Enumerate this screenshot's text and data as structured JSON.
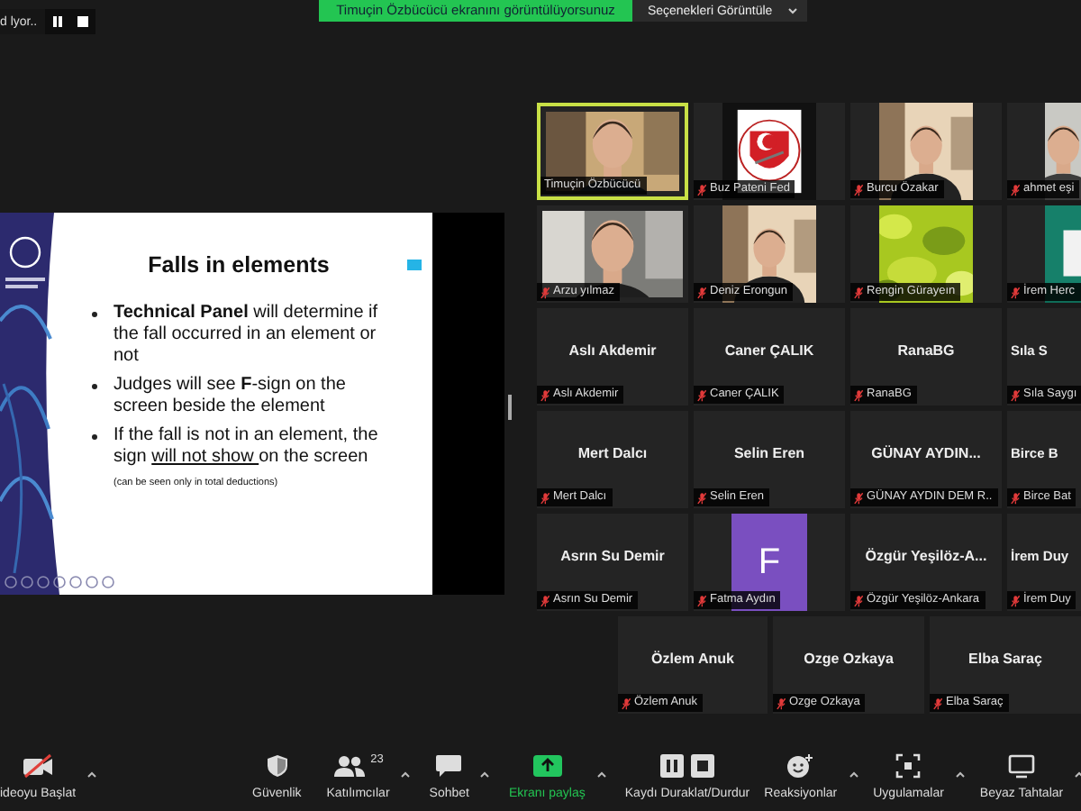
{
  "top_bar": {
    "recording_status": "d lyor..",
    "share_notice": "Timuçin Özbücücü ekranını görüntülüyorsunuz",
    "options_button": "Seçenekleri Görüntüle"
  },
  "slide": {
    "title": "Falls in elements",
    "bullets": [
      {
        "parts": [
          {
            "kind": "bold",
            "text": "Technical Panel"
          },
          {
            "kind": "plain",
            "text": " will determine if the fall occurred in an element or not"
          }
        ]
      },
      {
        "parts": [
          {
            "kind": "plain",
            "text": "Judges will see "
          },
          {
            "kind": "bold",
            "text": "F"
          },
          {
            "kind": "plain",
            "text": "-sign on the screen beside the element"
          }
        ]
      },
      {
        "parts": [
          {
            "kind": "plain",
            "text": "If the fall is not in an element, the sign "
          },
          {
            "kind": "underline",
            "text": "will not show "
          },
          {
            "kind": "plain",
            "text": "on the screen"
          },
          {
            "kind": "small",
            "text": " (can be seen only in total deductions)"
          }
        ]
      }
    ]
  },
  "participants": [
    {
      "kind": "video",
      "label": "Timuçin Özbücücü",
      "muted": false,
      "speaking": true
    },
    {
      "kind": "video",
      "label": "Buz Pateni Fed",
      "muted": true,
      "speaking": false
    },
    {
      "kind": "video",
      "label": "Burcu Özakar",
      "muted": true,
      "speaking": false
    },
    {
      "kind": "video",
      "label": "ahmet eşi",
      "muted": true,
      "speaking": false
    },
    {
      "kind": "video",
      "label": "Arzu yılmaz",
      "muted": true,
      "speaking": false
    },
    {
      "kind": "video",
      "label": "Deniz Erongun",
      "muted": true,
      "speaking": false
    },
    {
      "kind": "video",
      "label": "Rengin Gürayeın",
      "muted": true,
      "speaking": false
    },
    {
      "kind": "video",
      "label": "İrem Herc",
      "muted": true,
      "speaking": false
    },
    {
      "kind": "name",
      "display_name": "Aslı Akdemir",
      "label": "Aslı Akdemir",
      "muted": true,
      "speaking": false
    },
    {
      "kind": "name",
      "display_name": "Caner ÇALIK",
      "label": "Caner ÇALIK",
      "muted": true,
      "speaking": false
    },
    {
      "kind": "name",
      "display_name": "RanaBG",
      "label": "RanaBG",
      "muted": true,
      "speaking": false
    },
    {
      "kind": "name",
      "display_name": "Sıla S",
      "label": "Sıla Saygı",
      "muted": true,
      "speaking": false
    },
    {
      "kind": "name",
      "display_name": "Mert Dalcı",
      "label": "Mert Dalcı",
      "muted": true,
      "speaking": false
    },
    {
      "kind": "name",
      "display_name": "Selin Eren",
      "label": "Selin Eren",
      "muted": true,
      "speaking": false
    },
    {
      "kind": "name",
      "display_name": "GÜNAY AYDIN...",
      "label": "GÜNAY AYDIN DEM R..",
      "muted": true,
      "speaking": false
    },
    {
      "kind": "name",
      "display_name": "Birce B",
      "label": "Birce Bat",
      "muted": true,
      "speaking": false
    },
    {
      "kind": "name",
      "display_name": "Asrın Su Demir",
      "label": "Asrın Su Demir",
      "muted": true,
      "speaking": false
    },
    {
      "kind": "avatar",
      "initial": "F",
      "label": "Fatma Aydın",
      "muted": true,
      "speaking": false
    },
    {
      "kind": "name",
      "display_name": "Özgür  Yeşilöz-A...",
      "label": "Özgür Yeşilöz-Ankara",
      "muted": true,
      "speaking": false
    },
    {
      "kind": "name",
      "display_name": "İrem Duy",
      "label": "İrem Duy",
      "muted": true,
      "speaking": false
    },
    {
      "kind": "name",
      "display_name": "Özlem Anuk",
      "label": "Özlem Anuk",
      "muted": true,
      "speaking": false
    },
    {
      "kind": "name",
      "display_name": "Ozge Ozkaya",
      "label": "Ozge Ozkaya",
      "muted": true,
      "speaking": false
    },
    {
      "kind": "name",
      "display_name": "Elba Saraç",
      "label": "Elba Saraç",
      "muted": true,
      "speaking": false
    }
  ],
  "toolbar": [
    {
      "kind": "video",
      "label": "ideoyu Başlat",
      "caret": true
    },
    {
      "kind": "security",
      "label": "Güvenlik",
      "caret": false
    },
    {
      "kind": "participants",
      "label": "Katılımcılar",
      "count": "23",
      "caret": true
    },
    {
      "kind": "chat",
      "label": "Sohbet",
      "caret": true
    },
    {
      "kind": "share",
      "label": "Ekranı paylaş",
      "caret": true
    },
    {
      "kind": "record",
      "label": "Kaydı Duraklat/Durdur",
      "caret": false
    },
    {
      "kind": "reactions",
      "label": "Reaksiyonlar",
      "caret": true
    },
    {
      "kind": "apps",
      "label": "Uygulamalar",
      "caret": true
    },
    {
      "kind": "whiteboard",
      "label": "Beyaz Tahtalar",
      "caret": true
    }
  ]
}
